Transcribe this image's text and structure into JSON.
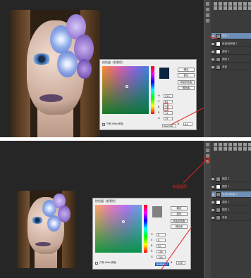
{
  "top": {
    "dialog": {
      "title": "拾色器（前景色）",
      "buttons": [
        "确定",
        "复位",
        "添加到色板",
        "颜色库"
      ],
      "fields": [
        {
          "label": "H",
          "value": "210"
        },
        {
          "label": "S",
          "value": "82"
        },
        {
          "label": "B",
          "value": "25"
        },
        {
          "label": "R",
          "value": "11"
        },
        {
          "label": "G",
          "value": "37"
        },
        {
          "label": "B",
          "value": "64"
        }
      ],
      "hex": "0b2540",
      "web_only_label": "只有 Web 颜色",
      "new_color": "#0b2540",
      "current_color": "#0b2540"
    },
    "layers": [
      {
        "name": "图层 1",
        "selected": true
      },
      {
        "name": "色相/饱和度 1",
        "selected": false
      },
      {
        "name": "曲线 1",
        "selected": false
      },
      {
        "name": "图层 0",
        "selected": false
      },
      {
        "name": "背景",
        "selected": false
      }
    ]
  },
  "bottom": {
    "dialog": {
      "title": "拾色器（前景色）",
      "buttons": [
        "确定",
        "复位",
        "添加到色板",
        "颜色库"
      ],
      "fields": [
        {
          "label": "H",
          "value": "0"
        },
        {
          "label": "S",
          "value": "0"
        },
        {
          "label": "B",
          "value": "50"
        },
        {
          "label": "R",
          "value": "128"
        },
        {
          "label": "G",
          "value": "128"
        },
        {
          "label": "B",
          "value": "128"
        }
      ],
      "hex": "808080",
      "web_only_label": "只有 Web 颜色",
      "new_color": "#808080",
      "current_color": "#808080"
    },
    "layers": [
      {
        "name": "图层 2",
        "selected": false
      },
      {
        "name": "图层 1",
        "selected": false
      },
      {
        "name": "色相/饱和度 1",
        "selected": true
      },
      {
        "name": "曲线 1",
        "selected": false
      },
      {
        "name": "图层 0",
        "selected": false
      },
      {
        "name": "背景",
        "selected": false
      }
    ],
    "annotation": "新建图层"
  }
}
